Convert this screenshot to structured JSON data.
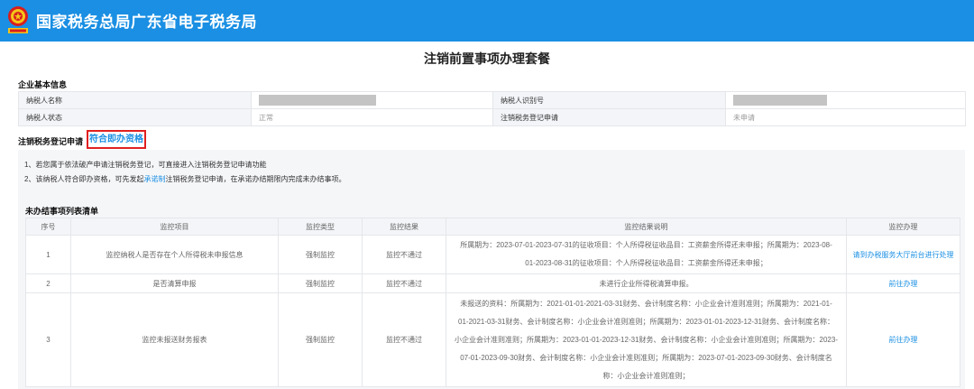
{
  "header": {
    "site_title": "国家税务总局广东省电子税务局",
    "bg_color": "#1a8fe3"
  },
  "page_title": "注销前置事项办理套餐",
  "basic_info": {
    "section_title": "企业基本信息",
    "rows": [
      {
        "label1": "纳税人名称",
        "value1": "",
        "label2": "纳税人识别号",
        "value2": ""
      },
      {
        "label1": "纳税人状态",
        "value1": "正常",
        "label2": "注销税务登记申请",
        "value2": "未申请"
      }
    ]
  },
  "cancel_section": {
    "title": "注销税务登记申请",
    "qualification": "符合即办资格",
    "note1": "1、若您属于依法破产申请注销税务登记，可直接进入注销税务登记申请功能",
    "note2_prefix": "2、该纳税人符合即办资格，可先发起",
    "note2_link": "承诺制",
    "note2_suffix": "注销税务登记申请，在承诺办结期限内完成未办结事项。"
  },
  "pending_list": {
    "title": "未办结事项列表清单",
    "headers": [
      "序号",
      "监控项目",
      "监控类型",
      "监控结果",
      "监控结果说明",
      "监控办理"
    ],
    "rows": [
      {
        "no": "1",
        "item": "监控纳税人是否存在个人所得税未申报信息",
        "type": "强制监控",
        "result": "监控不通过",
        "desc": [
          "所属期为：2023-07-01-2023-07-31的征收项目：个人所得税征收品目：工资薪金所得还未申报；所属期为：2023-08-",
          "01-2023-08-31的征收项目：个人所得税征收品目：工资薪金所得还未申报；"
        ],
        "action": "请到办税服务大厅前台进行处理"
      },
      {
        "no": "2",
        "item": "是否清算申报",
        "type": "强制监控",
        "result": "监控不通过",
        "desc": [
          "未进行企业所得税清算申报。"
        ],
        "action": "前往办理"
      },
      {
        "no": "3",
        "item": "监控未报送财务报表",
        "type": "强制监控",
        "result": "监控不通过",
        "desc": [
          "未报送的资料：所属期为：2021-01-01-2021-03-31财务、会计制度名称：小企业会计准则准则；所属期为：2021-01-",
          "01-2021-03-31财务、会计制度名称：小企业会计准则准则；所属期为：2023-01-01-2023-12-31财务、会计制度名称：",
          "小企业会计准则准则；所属期为：2023-01-01-2023-12-31财务、会计制度名称：小企业会计准则准则；所属期为：2023-",
          "07-01-2023-09-30财务、会计制度名称：小企业会计准则准则；所属期为：2023-07-01-2023-09-30财务、会计制度名",
          "称：小企业会计准则准则；"
        ],
        "action": "前往办理"
      }
    ]
  }
}
